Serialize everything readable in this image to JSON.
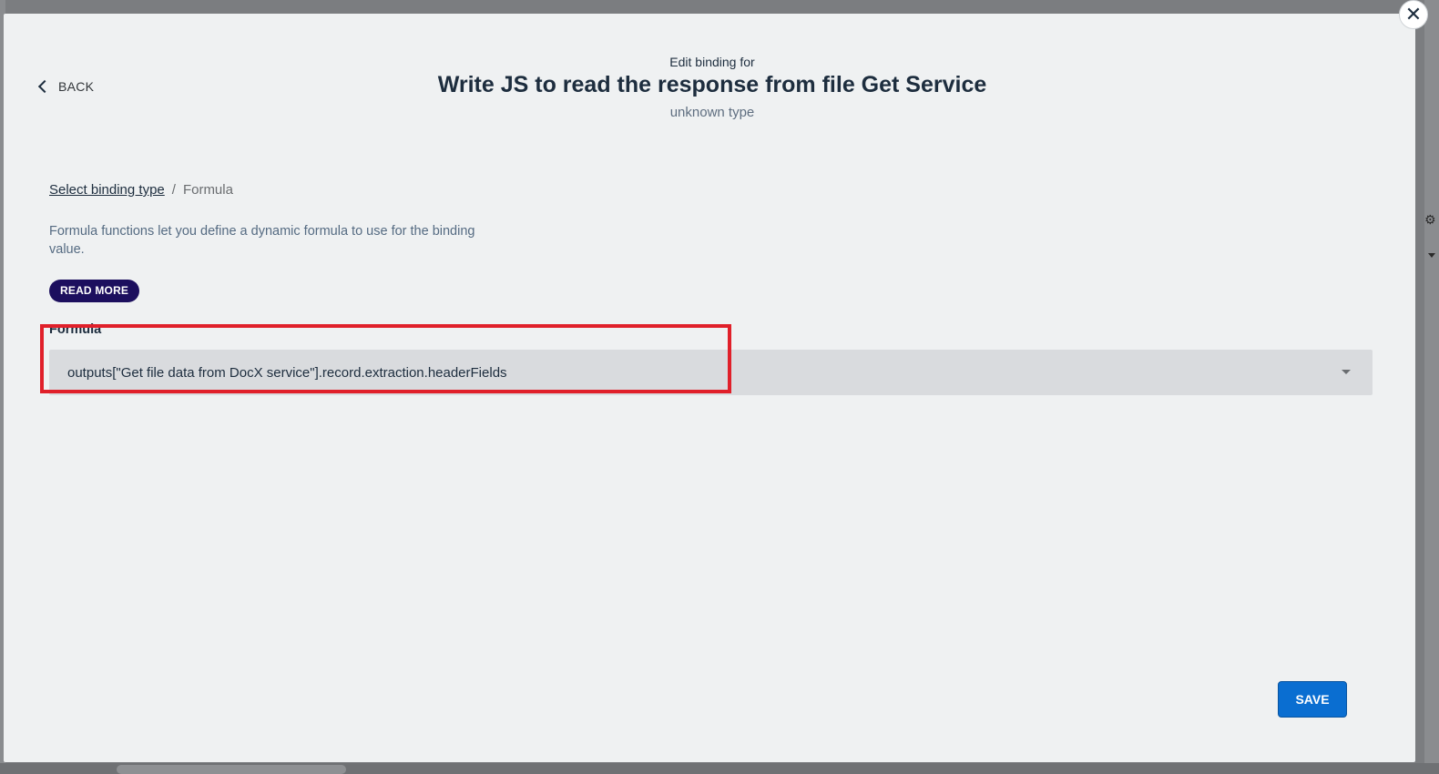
{
  "header": {
    "pre_title": "Edit binding for",
    "title": "Write JS to read the response from file Get Service",
    "subtitle": "unknown type"
  },
  "nav": {
    "back_label": "BACK",
    "close_icon": "close-icon"
  },
  "breadcrumb": {
    "link": "Select binding type",
    "separator": "/",
    "current": "Formula"
  },
  "description": "Formula functions let you define a dynamic formula to use for the binding value.",
  "read_more_label": "READ MORE",
  "formula": {
    "label": "Formula",
    "value": "outputs[\"Get file data from DocX service\"].record.extraction.headerFields"
  },
  "footer": {
    "save_label": "SAVE"
  },
  "colors": {
    "accent": "#0a6ed1",
    "read_more_bg": "#1c0f5e",
    "highlight": "#e0202a",
    "modal_bg": "#eff1f2"
  }
}
